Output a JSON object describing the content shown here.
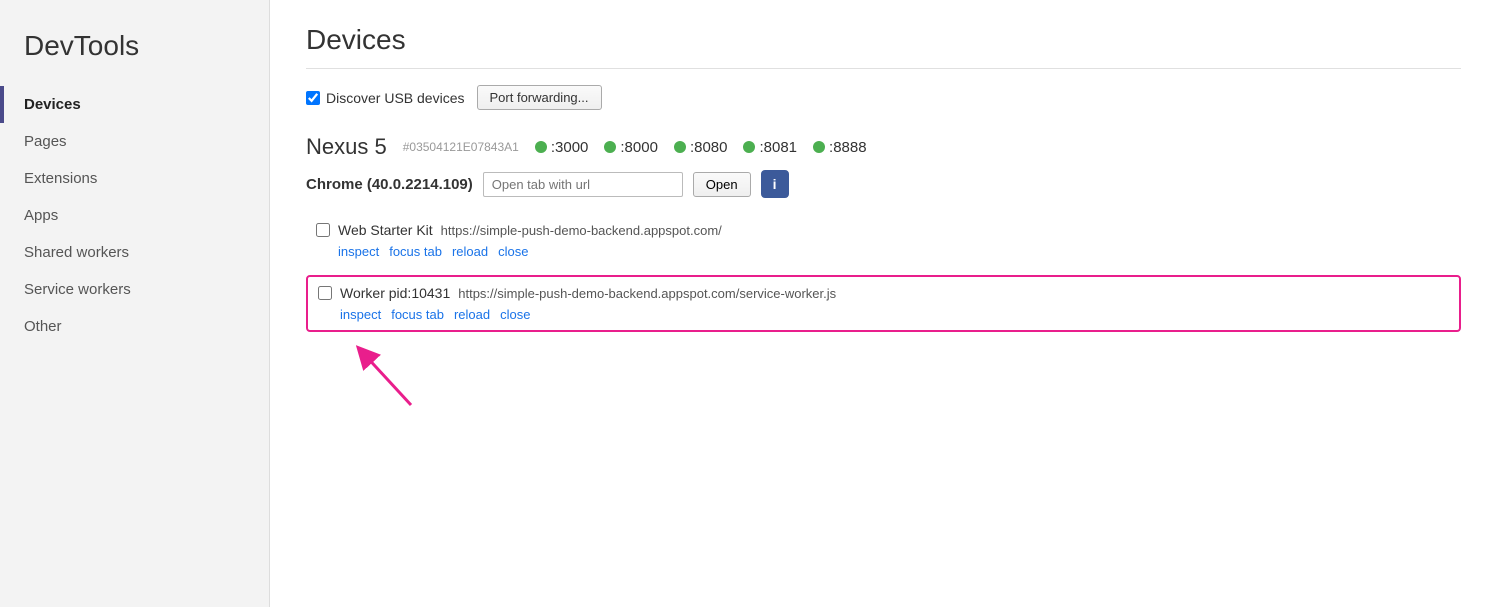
{
  "app": {
    "title": "DevTools"
  },
  "sidebar": {
    "items": [
      {
        "id": "devices",
        "label": "Devices",
        "active": true
      },
      {
        "id": "pages",
        "label": "Pages",
        "active": false
      },
      {
        "id": "extensions",
        "label": "Extensions",
        "active": false
      },
      {
        "id": "apps",
        "label": "Apps",
        "active": false
      },
      {
        "id": "shared-workers",
        "label": "Shared workers",
        "active": false
      },
      {
        "id": "service-workers",
        "label": "Service workers",
        "active": false
      },
      {
        "id": "other",
        "label": "Other",
        "active": false
      }
    ]
  },
  "main": {
    "page_title": "Devices",
    "toolbar": {
      "discover_label": "Discover USB devices",
      "port_forwarding_button": "Port forwarding..."
    },
    "device": {
      "name": "Nexus 5",
      "id": "#03504121E07843A1",
      "ports": [
        ":3000",
        ":8000",
        ":8080",
        ":8081",
        ":8888"
      ],
      "browser": "Chrome (40.0.2214.109)",
      "url_placeholder": "Open tab with url",
      "open_button": "Open",
      "info_icon_label": "i"
    },
    "tabs": [
      {
        "name": "Web Starter Kit",
        "url": "https://simple-push-demo-backend.appspot.com/",
        "highlighted": false,
        "actions": [
          "inspect",
          "focus tab",
          "reload",
          "close"
        ]
      },
      {
        "name": "Worker pid:10431",
        "url": "https://simple-push-demo-backend.appspot.com/service-worker.js",
        "highlighted": true,
        "actions": [
          "inspect",
          "focus tab",
          "reload",
          "close"
        ]
      }
    ]
  }
}
